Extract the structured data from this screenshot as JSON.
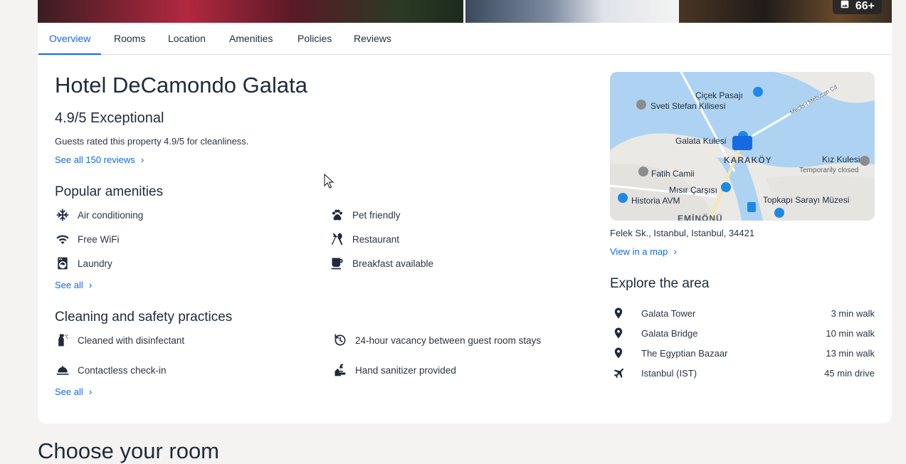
{
  "gallery": {
    "photo_count": "66+",
    "icon": "image-icon"
  },
  "tabs": [
    {
      "label": "Overview",
      "active": true
    },
    {
      "label": "Rooms"
    },
    {
      "label": "Location"
    },
    {
      "label": "Amenities"
    },
    {
      "label": "Policies"
    },
    {
      "label": "Reviews"
    }
  ],
  "hotel": {
    "name": "Hotel DeCamondo Galata",
    "rating": "4.9/5 Exceptional",
    "cleanliness_note": "Guests rated this property 4.9/5 for cleanliness.",
    "reviews_link": "See all 150 reviews"
  },
  "amenities": {
    "title": "Popular amenities",
    "items": [
      {
        "label": "Air conditioning",
        "icon": "snowflake-icon"
      },
      {
        "label": "Pet friendly",
        "icon": "paw-icon"
      },
      {
        "label": "Free WiFi",
        "icon": "wifi-icon"
      },
      {
        "label": "Restaurant",
        "icon": "utensils-icon"
      },
      {
        "label": "Laundry",
        "icon": "washing-machine-icon"
      },
      {
        "label": "Breakfast available",
        "icon": "coffee-cup-icon"
      }
    ],
    "see_all": "See all"
  },
  "cleaning": {
    "title": "Cleaning and safety practices",
    "items": [
      {
        "label": "Cleaned with disinfectant",
        "icon": "spray-bottle-icon"
      },
      {
        "label": "24-hour vacancy between guest room stays",
        "icon": "clock-refresh-icon"
      },
      {
        "label": "Contactless check-in",
        "icon": "service-bell-icon"
      },
      {
        "label": "Hand sanitizer provided",
        "icon": "hand-sanitizer-icon"
      }
    ],
    "see_all": "See all"
  },
  "map": {
    "labels": {
      "cicek": "Çiçek Pasajı",
      "sveti": "Sveti Stefan Kilisesi",
      "galata": "Galata Kulesi",
      "karakoy": "KARAKÖY",
      "kiz": "Kız Kulesi",
      "kiz_status": "Temporarily closed",
      "fatih": "Fatih Camii",
      "misir": "Mısır Çarşısı",
      "historia": "Historia AVM",
      "topkapi": "Topkapı Sarayı Müzesi",
      "eminonu": "EMİNÖNÜ",
      "street": "Meclis-i Mebusan Cd"
    },
    "address": "Felek Sk., Istanbul, Istanbul, 34421",
    "view_link": "View in a map"
  },
  "explore": {
    "title": "Explore the area",
    "places": [
      {
        "name": "Galata Tower",
        "distance": "3 min walk",
        "icon": "map-pin-icon"
      },
      {
        "name": "Galata Bridge",
        "distance": "10 min walk",
        "icon": "map-pin-icon"
      },
      {
        "name": "The Egyptian Bazaar",
        "distance": "13 min walk",
        "icon": "map-pin-icon"
      },
      {
        "name": "Istanbul (IST)",
        "distance": "45 min drive",
        "icon": "airplane-icon"
      }
    ]
  },
  "next_section": {
    "title": "Choose your room"
  }
}
